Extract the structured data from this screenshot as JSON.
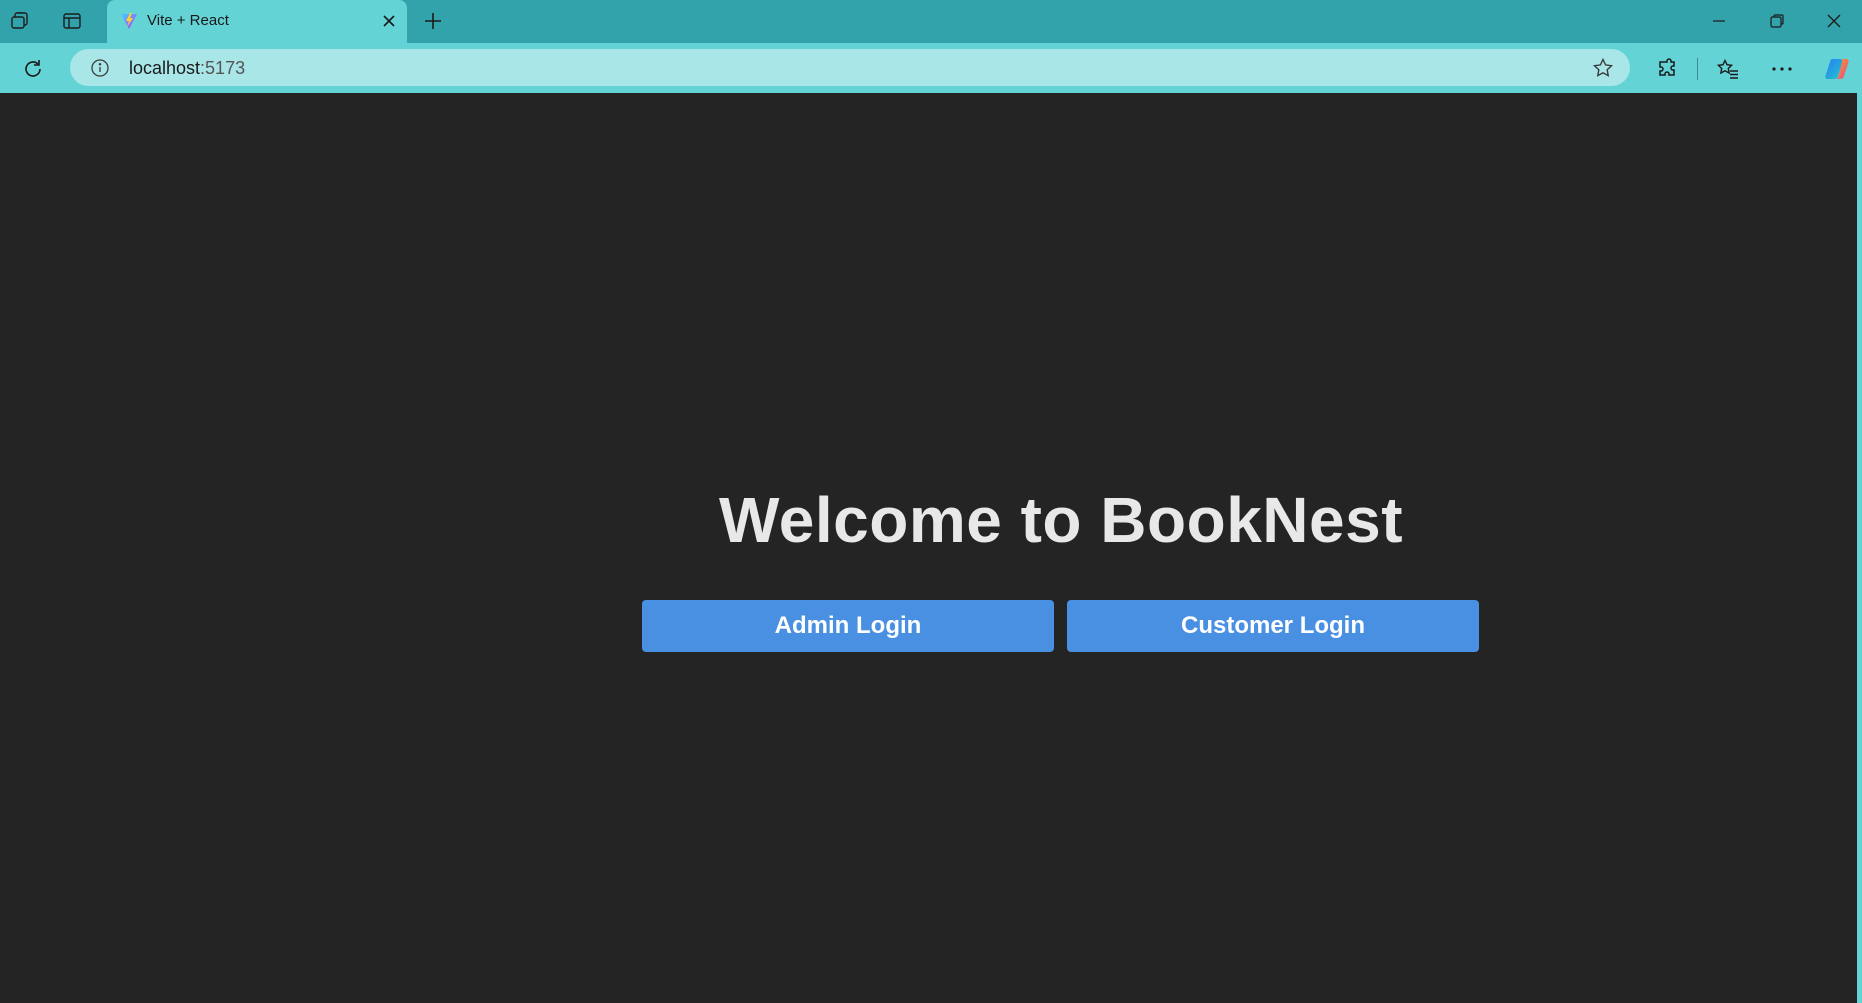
{
  "browser": {
    "tab": {
      "title": "Vite + React",
      "favicon": "vite-logo-icon"
    },
    "address": {
      "host": "localhost",
      "port": ":5173"
    },
    "colors": {
      "frame": "#33a3ab",
      "toolbar": "#64d3d6",
      "address_bg": "#a9e6e7"
    }
  },
  "page": {
    "heading": "Welcome to BookNest",
    "buttons": {
      "admin": "Admin Login",
      "customer": "Customer Login"
    },
    "colors": {
      "background": "#242424",
      "button": "#4a90e2",
      "heading": "#e8e8e8"
    }
  }
}
